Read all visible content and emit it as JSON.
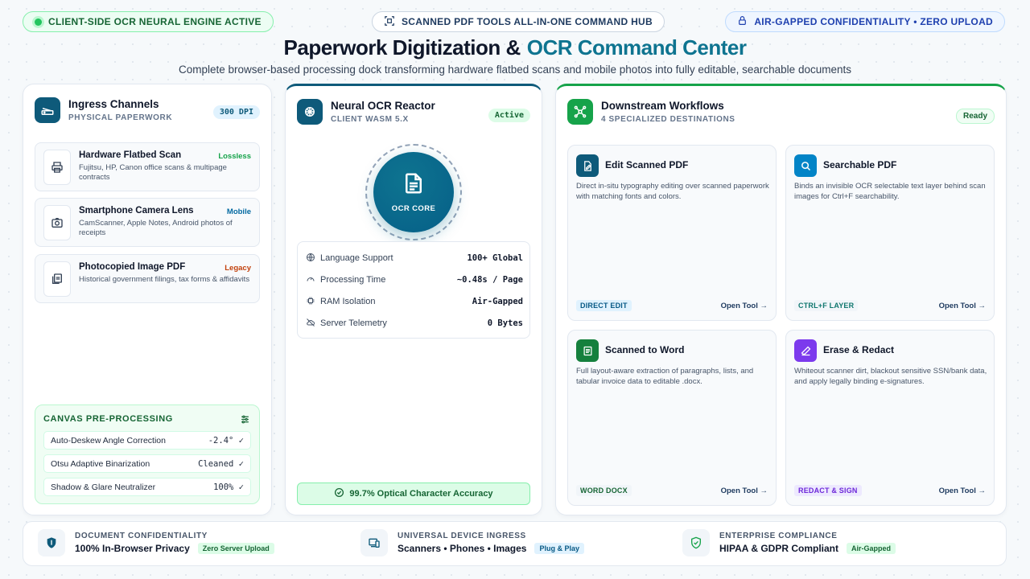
{
  "top": {
    "status_left": "CLIENT-SIDE OCR NEURAL ENGINE ACTIVE",
    "hub_label": "SCANNED PDF TOOLS ALL-IN-ONE COMMAND HUB",
    "privacy_label": "AIR-GAPPED CONFIDENTIALITY • ZERO UPLOAD",
    "title_main": "Paperwork Digitization &",
    "title_accent": "OCR Command Center",
    "subtitle": "Complete browser-based processing dock transforming hardware flatbed scans and mobile photos into fully editable, searchable documents"
  },
  "ingress": {
    "title": "Ingress Channels",
    "subtitle": "PHYSICAL PAPERWORK",
    "badge": "300 DPI",
    "items": [
      {
        "title": "Hardware Flatbed Scan",
        "desc": "Fujitsu, HP, Canon office scans & multipage contracts",
        "tag": "Lossless",
        "tag_color": "#16a34a"
      },
      {
        "title": "Smartphone Camera Lens",
        "desc": "CamScanner, Apple Notes, Android photos of receipts",
        "tag": "Mobile",
        "tag_color": "#0369a1"
      },
      {
        "title": "Photocopied Image PDF",
        "desc": "Historical government filings, tax forms & affidavits",
        "tag": "Legacy",
        "tag_color": "#c2410c"
      }
    ],
    "preprocessing": {
      "title": "CANVAS PRE-PROCESSING",
      "rows": [
        {
          "label": "Auto-Deskew Angle Correction",
          "value": "-2.4° ✓"
        },
        {
          "label": "Otsu Adaptive Binarization",
          "value": "Cleaned ✓"
        },
        {
          "label": "Shadow & Glare Neutralizer",
          "value": "100% ✓"
        }
      ]
    }
  },
  "reactor": {
    "title": "Neural OCR Reactor",
    "subtitle": "CLIENT WASM 5.X",
    "badge": "Active",
    "core_label": "OCR CORE",
    "metrics": [
      {
        "label": "Language Support",
        "value": "100+ Global",
        "icon": "globe-icon"
      },
      {
        "label": "Processing Time",
        "value": "~0.48s / Page",
        "icon": "gauge-icon"
      },
      {
        "label": "RAM Isolation",
        "value": "Air-Gapped",
        "icon": "chip-icon"
      },
      {
        "label": "Server Telemetry",
        "value": "0 Bytes",
        "icon": "cloud-off-icon"
      }
    ],
    "accuracy": "99.7% Optical Character Accuracy"
  },
  "workflows": {
    "title": "Downstream Workflows",
    "subtitle": "4 SPECIALIZED DESTINATIONS",
    "badge": "Ready",
    "tiles": [
      {
        "title": "Edit Scanned PDF",
        "desc": "Direct in-situ typography editing over scanned paperwork with matching fonts and colors.",
        "tag": "DIRECT EDIT",
        "link": "Open Tool →",
        "color": "#0e5a7a",
        "tag_bg": "#e0f2fe",
        "tag_fg": "#075985"
      },
      {
        "title": "Searchable PDF",
        "desc": "Binds an invisible OCR selectable text layer behind scan images for Ctrl+F searchability.",
        "tag": "CTRL+F LAYER",
        "link": "Open Tool →",
        "color": "#0284c7",
        "tag_bg": "#f1f5f9",
        "tag_fg": "#0f766e"
      },
      {
        "title": "Scanned to Word",
        "desc": "Full layout-aware extraction of paragraphs, lists, and tabular invoice data to editable .docx.",
        "tag": "WORD DOCX",
        "link": "Open Tool →",
        "color": "#15803d",
        "tag_bg": "#f1f5f9",
        "tag_fg": "#166534"
      },
      {
        "title": "Erase & Redact",
        "desc": "Whiteout scanner dirt, blackout sensitive SSN/bank data, and apply legally binding e-signatures.",
        "tag": "REDACT & SIGN",
        "link": "Open Tool →",
        "color": "#7c3aed",
        "tag_bg": "#ede9fe",
        "tag_fg": "#6d28d9"
      }
    ]
  },
  "footer": [
    {
      "kicker": "DOCUMENT CONFIDENTIALITY",
      "main": "100% In-Browser Privacy",
      "tag": "Zero Server Upload",
      "tag_bg": "#dcfce7",
      "tag_fg": "#166534"
    },
    {
      "kicker": "UNIVERSAL DEVICE INGRESS",
      "main": "Scanners • Phones • Images",
      "tag": "Plug & Play",
      "tag_bg": "#e0f2fe",
      "tag_fg": "#075985"
    },
    {
      "kicker": "ENTERPRISE COMPLIANCE",
      "main": "HIPAA & GDPR Compliant",
      "tag": "Air-Gapped",
      "tag_bg": "#dcfce7",
      "tag_fg": "#166534"
    }
  ],
  "colors": {
    "accent": "#0e7490",
    "success": "#22c55e",
    "brand_dark": "#0f172a"
  }
}
